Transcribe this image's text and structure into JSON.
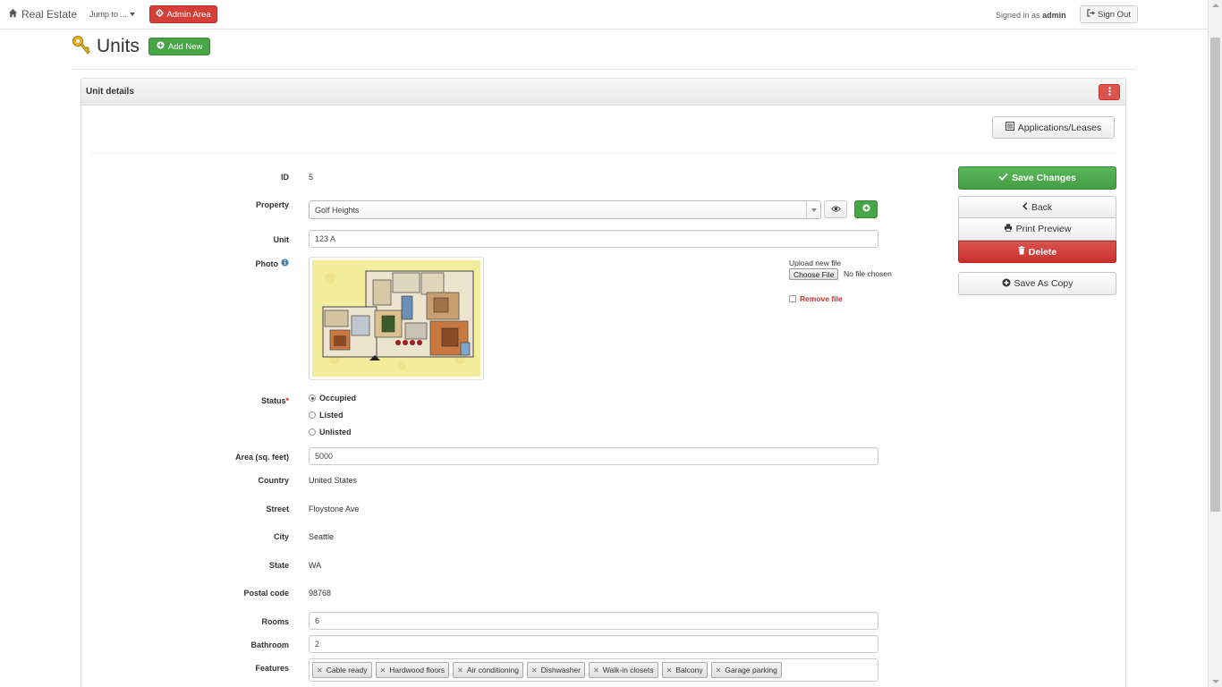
{
  "navbar": {
    "brand": "Real Estate",
    "jump_to": "Jump to ...",
    "admin_area": "Admin Area",
    "signed_in_prefix": "Signed in as",
    "signed_in_user": "admin",
    "sign_out": "Sign Out"
  },
  "page": {
    "title": "Units",
    "add_new": "Add New"
  },
  "panel": {
    "title": "Unit details",
    "applications_leases": "Applications/Leases"
  },
  "actions": {
    "save_changes": "Save Changes",
    "back": "Back",
    "print_preview": "Print Preview",
    "delete": "Delete",
    "save_as_copy": "Save As Copy"
  },
  "form": {
    "id_label": "ID",
    "id_value": "5",
    "property_label": "Property",
    "property_value": "Golf Heights",
    "unit_label": "Unit",
    "unit_value": "123 A",
    "photo_label": "Photo",
    "upload_label": "Upload new file",
    "choose_file": "Choose File",
    "no_file": "No file chosen",
    "remove_file": "Remove file",
    "status_label": "Status",
    "status_required_mark": "*",
    "status_options": [
      "Occupied",
      "Listed",
      "Unlisted"
    ],
    "status_selected": "Occupied",
    "area_label": "Area (sq. feet)",
    "area_value": "5000",
    "country_label": "Country",
    "country_value": "United States",
    "street_label": "Street",
    "street_value": "Floystone Ave",
    "city_label": "City",
    "city_value": "Seattle",
    "state_label": "State",
    "state_value": "WA",
    "postal_label": "Postal code",
    "postal_value": "98768",
    "rooms_label": "Rooms",
    "rooms_value": "6",
    "bathroom_label": "Bathroom",
    "bathroom_value": "2",
    "features_label": "Features",
    "features": [
      "Cable ready",
      "Hardwood floors",
      "Air conditioning",
      "Dishwasher",
      "Walk-in closets",
      "Balcony",
      "Garage parking"
    ]
  },
  "colors": {
    "admin_red": "#d43f3a",
    "success_green": "#5cb85c",
    "danger_red": "#d9534f",
    "required_red": "#c9302c"
  },
  "icons": {
    "brand": "home-icon",
    "admin": "gear-icon",
    "sign_out": "sign-out-icon",
    "page": "key-icon",
    "add": "plus-circle-icon",
    "menu": "vertical-dots-icon",
    "applications": "list-icon",
    "save": "check-icon",
    "back": "chevron-left-icon",
    "print": "print-icon",
    "delete": "trash-icon",
    "copy": "plus-circle-icon",
    "view": "eye-icon",
    "info": "info-icon"
  }
}
